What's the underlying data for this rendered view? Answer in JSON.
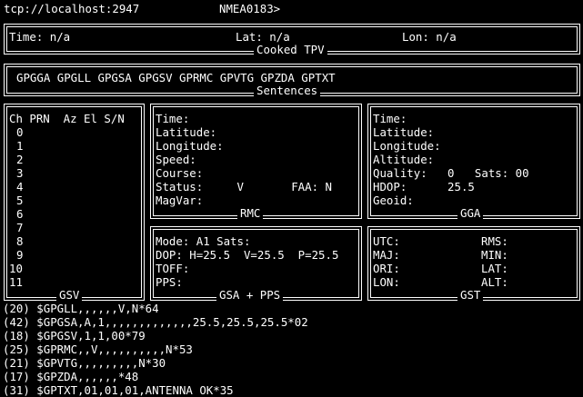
{
  "header": {
    "address": "tcp://localhost:2947",
    "mode": "NMEA0183>"
  },
  "tpv": {
    "title": "Cooked TPV",
    "time": "Time: n/a",
    "lat": "Lat: n/a",
    "lon": "Lon: n/a"
  },
  "sentences": {
    "title": "Sentences",
    "list": "GPGGA GPGLL GPGSA GPGSV GPRMC GPVTG GPZDA GPTXT"
  },
  "gsv": {
    "title": "GSV",
    "header": "Ch PRN  Az El S/N",
    "channels": [
      "0",
      "1",
      "2",
      "3",
      "4",
      "5",
      "6",
      "7",
      "8",
      "9",
      "10",
      "11"
    ]
  },
  "rmc": {
    "title": "RMC",
    "time": "Time:",
    "latitude": "Latitude:",
    "longitude": "Longitude:",
    "speed": "Speed:",
    "course": "Course:",
    "status": "Status:     V       FAA: N",
    "magvar": "MagVar:"
  },
  "gga": {
    "title": "GGA",
    "time": "Time:",
    "latitude": "Latitude:",
    "longitude": "Longitude:",
    "altitude": "Altitude:",
    "quality": "Quality:   0   Sats: 00",
    "hdop": "HDOP:      25.5",
    "geoid": "Geoid:"
  },
  "gsa": {
    "title": "GSA + PPS",
    "mode": "Mode: A1 Sats:",
    "dop": "DOP: H=25.5  V=25.5  P=25.5",
    "toff": "TOFF:",
    "pps": "PPS:"
  },
  "gst": {
    "title": "GST",
    "utc": "UTC:",
    "rms": "RMS:",
    "maj": "MAJ:",
    "min": "MIN:",
    "ori": "ORI:",
    "lat": "LAT:",
    "lon": "LON:",
    "alt": "ALT:"
  },
  "log": [
    "(20) $GPGLL,,,,,,V,N*64",
    "(42) $GPGSA,A,1,,,,,,,,,,,,,25.5,25.5,25.5*02",
    "(18) $GPGSV,1,1,00*79",
    "(25) $GPRMC,,V,,,,,,,,,,N*53",
    "(21) $GPVTG,,,,,,,,,N*30",
    "(17) $GPZDA,,,,,,*48",
    "(31) $GPTXT,01,01,01,ANTENNA OK*35"
  ]
}
